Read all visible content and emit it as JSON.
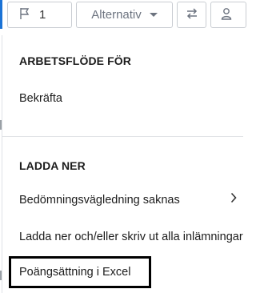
{
  "toolbar": {
    "flag_count": "1",
    "alternatives_label": "Alternativ"
  },
  "menu": {
    "section1_header": "ARBETSFLÖDE FÖR",
    "confirm_label": "Bekräfta",
    "section2_header": "LADDA NER",
    "grading_guide_label": "Bedömningsvägledning saknas",
    "download_label": "Ladda ner och/eller skriv ut alla inlämningar",
    "excel_label": "Poängsättning i Excel"
  },
  "icons": {
    "flag": "flag-icon",
    "caret": "chevron-down-icon",
    "swap": "swap-arrows-icon",
    "user": "user-icon",
    "submenu": "chevron-right-icon"
  },
  "colors": {
    "accent": "#1b73d6",
    "highlight_border": "#000000"
  }
}
